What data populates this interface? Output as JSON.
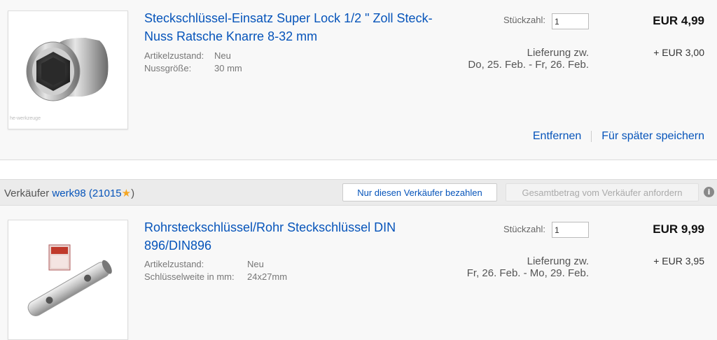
{
  "items": [
    {
      "title": "Steckschlüssel-Einsatz Super Lock 1/2 \" Zoll Steck-Nuss Ratsche Knarre 8-32 mm",
      "image_watermark": "he-werkzeuge",
      "specs": [
        {
          "key": "Artikelzustand:",
          "value": "Neu"
        },
        {
          "key": "Nussgröße:",
          "value": "30 mm"
        }
      ],
      "qty_label": "Stückzahl:",
      "qty_value": "1",
      "price": "EUR 4,99",
      "delivery_line1": "Lieferung zw.",
      "delivery_line2": "Do, 25. Feb. - Fr, 26. Feb.",
      "shipping": "+ EUR 3,00",
      "remove_label": "Entfernen",
      "save_later_label": "Für später speichern"
    },
    {
      "title": "Rohrsteckschlüssel/Rohr Steckschlüssel DIN 896/DIN896",
      "specs": [
        {
          "key": "Artikelzustand:",
          "value": "Neu"
        },
        {
          "key": "Schlüsselweite in mm:",
          "value": "24x27mm"
        }
      ],
      "qty_label": "Stückzahl:",
      "qty_value": "1",
      "price": "EUR 9,99",
      "delivery_line1": "Lieferung zw.",
      "delivery_line2": "Fr, 26. Feb. - Mo, 29. Feb.",
      "shipping": "+ EUR 3,95"
    }
  ],
  "seller": {
    "prefix": "Verkäufer",
    "name": "werk98",
    "rating_open": "(21015",
    "star": "★",
    "rating_close": ")",
    "pay_button": "Nur diesen Verkäufer bezahlen",
    "request_button": "Gesamtbetrag vom Verkäufer anfordern",
    "info_icon": "i"
  },
  "colors": {
    "link": "#0654ba",
    "star": "#f5a623",
    "background": "#f8f8f8"
  }
}
